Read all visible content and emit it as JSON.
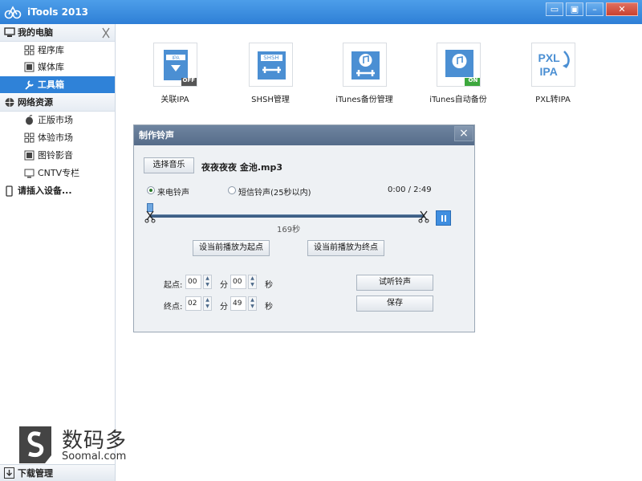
{
  "app": {
    "title": "iTools 2013"
  },
  "window_buttons": [
    {
      "name": "feedback-icon",
      "glyph": "▭"
    },
    {
      "name": "menu-icon",
      "glyph": "▣"
    },
    {
      "name": "minimize-icon",
      "glyph": "–"
    },
    {
      "name": "close-icon",
      "glyph": "✕"
    }
  ],
  "sidebar": {
    "my_computer": "我的电脑",
    "items_computer": [
      "程序库",
      "媒体库",
      "工具箱"
    ],
    "network": "网络资源",
    "items_network": [
      "正版市场",
      "体验市场",
      "图铃影音",
      "CNTV专栏"
    ],
    "device": "请插入设备...",
    "downloads": "下载管理"
  },
  "tools": [
    {
      "label": "关联IPA",
      "icon": "ipa-icon",
      "badge": "OFF"
    },
    {
      "label": "SHSH管理",
      "icon": "shsh-icon",
      "text": "SHSH"
    },
    {
      "label": "iTunes备份管理",
      "icon": "itunes-backup-icon"
    },
    {
      "label": "iTunes自动备份",
      "icon": "itunes-auto-backup-icon",
      "badge": "ON"
    },
    {
      "label": "PXL转IPA",
      "icon": "pxl-icon",
      "text1": "PXL",
      "text2": "IPA"
    }
  ],
  "dialog": {
    "title": "制作铃声",
    "close": "×",
    "choose_music": "选择音乐",
    "file_name": "夜夜夜夜 金池.mp3",
    "radio_call": "来电铃声",
    "radio_sms": "短信铃声(25秒以内)",
    "time_display": "0:00 / 2:49",
    "duration_label": "169秒",
    "set_start": "设当前播放为起点",
    "set_end": "设当前播放为终点",
    "start_label": "起点:",
    "end_label": "终点:",
    "minute_unit": "分",
    "second_unit": "秒",
    "start_min": "00",
    "start_sec": "00",
    "end_min": "02",
    "end_sec": "49",
    "preview": "试听铃声",
    "save": "保存",
    "progress": 0.0
  },
  "watermark": {
    "cn": "数码多",
    "en": "Soomal.com"
  }
}
